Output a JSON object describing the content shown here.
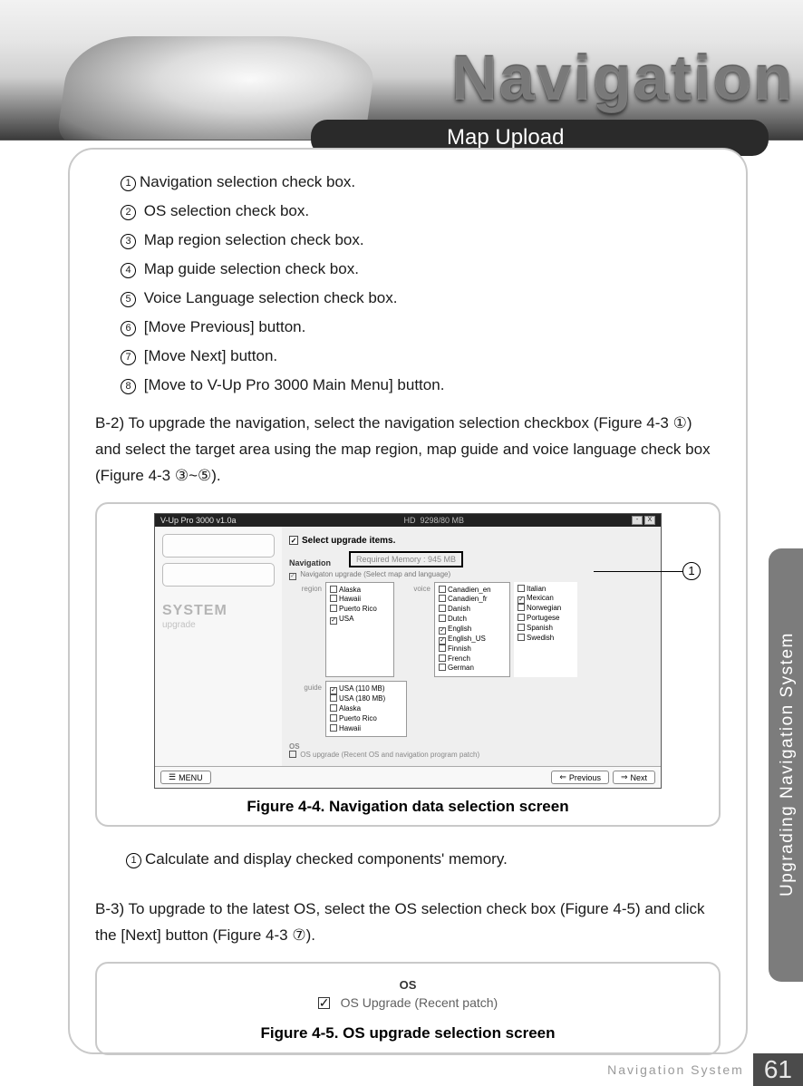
{
  "header": {
    "title_graphic": "Navigation",
    "section_tab": "Map Upload"
  },
  "numbered_list": [
    "Navigation selection check box.",
    "OS selection check box.",
    "Map region selection check box.",
    "Map guide selection check box.",
    "Voice Language selection check box.",
    "[Move Previous] button.",
    "[Move Next] button.",
    "[Move to V-Up Pro 3000 Main Menu] button."
  ],
  "para_b2_lead": "B-2) ",
  "para_b2": "To upgrade the navigation, select the navigation selection checkbox (Figure 4-3 ①) and select the target area using the map region, map guide and voice language check box (Figure 4-3 ③~⑤).",
  "figure44": {
    "title_bar": "V-Up Pro 3000  v1.0a",
    "hd_label": "HD",
    "hd_value": "9298/80 MB",
    "side_brand_top": "SYSTEM",
    "side_brand_sub": "upgrade",
    "select_header": "Select upgrade items.",
    "nav_label": "Navigation",
    "req_mem": "Required Memory : 945 MB",
    "nav_upgrade_line": "Navigaton upgrade (Select map and language)",
    "region_label": "region",
    "guide_label": "guide",
    "voice_label": "voice",
    "regions": [
      {
        "name": "Alaska",
        "checked": false
      },
      {
        "name": "Hawaii",
        "checked": false
      },
      {
        "name": "Puerto Rico",
        "checked": false
      },
      {
        "name": "USA",
        "checked": true
      }
    ],
    "guides": [
      {
        "name": "USA (110 MB)",
        "checked": true
      },
      {
        "name": "USA (180 MB)",
        "checked": false
      },
      {
        "name": "Alaska",
        "checked": false
      },
      {
        "name": "Puerto Rico",
        "checked": false
      },
      {
        "name": "Hawaii",
        "checked": false
      }
    ],
    "voices_col1": [
      {
        "name": "Canadien_en",
        "checked": false
      },
      {
        "name": "Canadien_fr",
        "checked": false
      },
      {
        "name": "Danish",
        "checked": false
      },
      {
        "name": "Dutch",
        "checked": false
      },
      {
        "name": "English",
        "checked": true
      },
      {
        "name": "English_US",
        "checked": true
      },
      {
        "name": "Finnish",
        "checked": false
      },
      {
        "name": "French",
        "checked": false
      },
      {
        "name": "German",
        "checked": false
      }
    ],
    "voices_col2": [
      {
        "name": "Italian",
        "checked": false
      },
      {
        "name": "Mexican",
        "checked": true
      },
      {
        "name": "Norwegian",
        "checked": false
      },
      {
        "name": "Portugese",
        "checked": false
      },
      {
        "name": "Spanish",
        "checked": false
      },
      {
        "name": "Swedish",
        "checked": false
      }
    ],
    "os_label": "OS",
    "os_line": "OS upgrade (Recent OS and navigation program patch)",
    "menu_btn": "MENU",
    "prev_btn": "Previous",
    "next_btn": "Next",
    "callout": "1",
    "caption": "Figure 4-4. Navigation data selection screen"
  },
  "sub_item_1": "Calculate and display checked components' memory.",
  "para_b3_lead": "B-3) ",
  "para_b3": "To upgrade to the latest OS, select the OS selection check box (Figure 4-5) and click the [Next] button (Figure 4-3 ⑦).",
  "figure45": {
    "os_title": "OS",
    "os_text": "OS Upgrade (Recent patch)",
    "caption": "Figure 4-5. OS upgrade selection screen"
  },
  "side_rail": "Upgrading Navigation System",
  "footer": {
    "label": "Navigation System",
    "page": "61"
  }
}
